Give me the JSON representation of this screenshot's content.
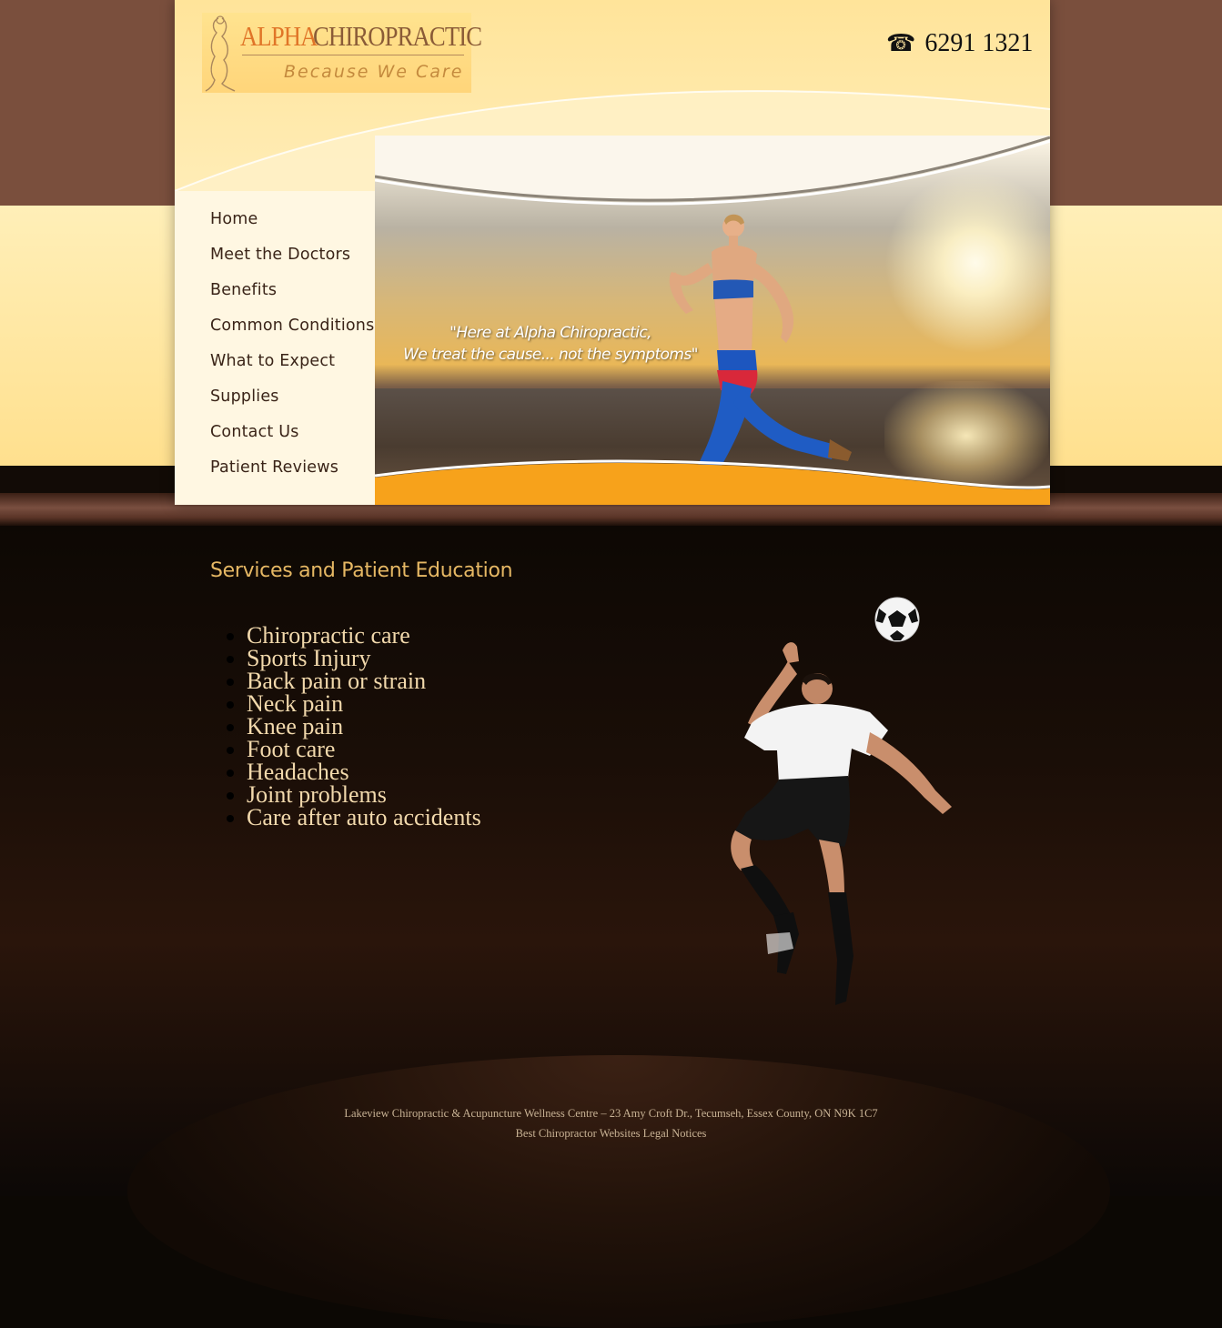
{
  "header": {
    "logo_word1": "ALPHA",
    "logo_word2": "CHIROPRACTIC",
    "logo_tagline": "Because We Care",
    "phone_icon": "phone-icon",
    "phone": "6291 1321"
  },
  "nav": {
    "items": [
      {
        "label": "Home"
      },
      {
        "label": "Meet the Doctors"
      },
      {
        "label": "Benefits"
      },
      {
        "label": "Common Conditions"
      },
      {
        "label": "What to Expect"
      },
      {
        "label": "Supplies"
      },
      {
        "label": "Contact Us"
      },
      {
        "label": "Patient Reviews"
      }
    ]
  },
  "hero": {
    "quote_line1": "\"Here at Alpha Chiropractic,",
    "quote_line2": "We treat the cause... not the symptoms\""
  },
  "main": {
    "title": "Services and Patient Education",
    "services": [
      "Chiropractic care",
      "Sports Injury",
      "Back pain or strain",
      "Neck pain",
      "Knee pain",
      "Foot care",
      "Headaches",
      "Joint problems",
      "Care after auto accidents"
    ]
  },
  "footer": {
    "address": "Lakeview Chiropractic & Acupuncture Wellness Centre – 23 Amy Croft Dr., Tecumseh, Essex County, ON N9K 1C7",
    "link1": "Best Chiropractor Websites",
    "link2": "Legal Notices"
  },
  "colors": {
    "brown_band": "#7a4f3d",
    "title_gold": "#e6b864",
    "list_text": "#f2d9ac",
    "accent_orange": "#f7a21b"
  }
}
